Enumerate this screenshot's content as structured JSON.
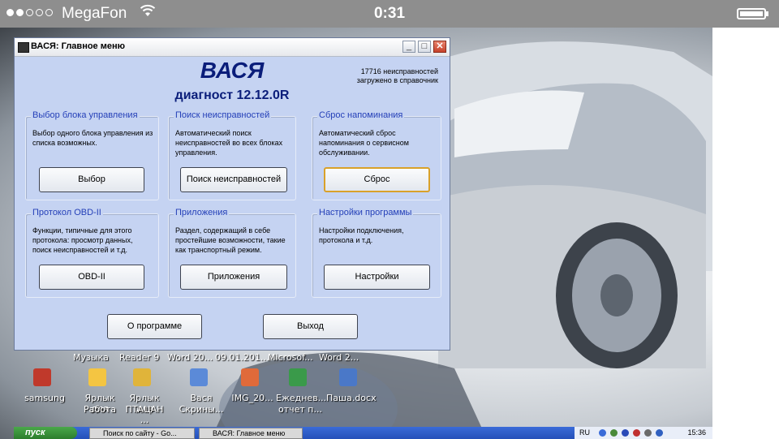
{
  "status_bar": {
    "carrier": "MegaFon",
    "time": "0:31",
    "signal_dots": [
      true,
      true,
      false,
      false,
      false
    ]
  },
  "window": {
    "title": "ВАСЯ: Главное меню",
    "app_name": "ВАСЯ",
    "version": "диагност 12.12.0R",
    "faults_count": "17716 неисправностей",
    "faults_loaded": "загружено в справочник",
    "groups": [
      {
        "label": "Выбор блока управления",
        "desc": "Выбор одного блока управления из списка возможных.",
        "button": "Выбор"
      },
      {
        "label": "Поиск неисправностей",
        "desc": "Автоматический поиск неисправностей во всех блоках управления.",
        "button": "Поиск неисправностей"
      },
      {
        "label": "Сброс напоминания",
        "desc": "Автоматический сброс напоминания о сервисном обслуживании.",
        "button": "Сброс"
      },
      {
        "label": "Протокол OBD-II",
        "desc": "Функции, типичные для этого протокола: просмотр данных, поиск неисправностей и т.д.",
        "button": "OBD-II"
      },
      {
        "label": "Приложения",
        "desc": "Раздел, содержащий в себе простейшие возможности, такие как транспортный режим.",
        "button": "Приложения"
      },
      {
        "label": "Настройки программы",
        "desc": "Настройки подключения, протокола и т.д.",
        "button": "Настройки"
      }
    ],
    "about_button": "О программе",
    "exit_button": "Выход"
  },
  "desktop": {
    "top_labels": [
      "Музыка",
      "Reader 9",
      "Word 20...",
      "09.01.201...",
      "Microsof...",
      "Word 2..."
    ],
    "icons": [
      {
        "line1": "samsung",
        "line2": "",
        "icon": "app-icon",
        "color": "#c0392b"
      },
      {
        "line1": "Ярлык для",
        "line2": "Работа",
        "icon": "folder-icon",
        "color": "#f4c542"
      },
      {
        "line1": "Ярлык для",
        "line2": "ПТАЦАН ...",
        "icon": "keys-icon",
        "color": "#e0b43a"
      },
      {
        "line1": "Вася",
        "line2": "Скрины...",
        "icon": "document-icon",
        "color": "#5b8ad8"
      },
      {
        "line1": "IMG_20...",
        "line2": "",
        "icon": "image-icon",
        "color": "#e06a3a"
      },
      {
        "line1": "Ежеднев...",
        "line2": "отчет п...",
        "icon": "excel-icon",
        "color": "#3a9a4a"
      },
      {
        "line1": "Паша.docx",
        "line2": "",
        "icon": "word-icon",
        "color": "#4a78c8"
      }
    ]
  },
  "taskbar": {
    "start": "пуск",
    "tasks": [
      "Поиск по сайту - Go...",
      "ВАСЯ: Главное меню"
    ],
    "lang": "RU",
    "time": "15:36"
  }
}
